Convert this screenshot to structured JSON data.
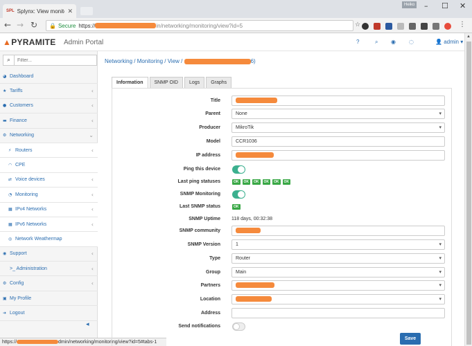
{
  "browser": {
    "tab_title": "Splynx: View monitoring",
    "tab_favicon": "SPL",
    "profile_name": "Heiko",
    "secure_label": "Secure",
    "url_scheme": "https://",
    "url_path": "in/networking/monitoring/view?id=5",
    "status_url_prefix": "https://",
    "status_url_suffix": "dmin/networking/monitoring/view?id=5#tabs-1"
  },
  "header": {
    "logo": "PYRAMITE",
    "portal_title": "Admin Portal",
    "user": "admin"
  },
  "sidebar": {
    "search_placeholder": "Filter...",
    "items": [
      {
        "icon": "dashboard-icon",
        "label": "Dashboard",
        "sub": false,
        "chevron": false
      },
      {
        "icon": "star-icon",
        "label": "Tariffs",
        "sub": false,
        "chevron": true
      },
      {
        "icon": "user-icon",
        "label": "Customers",
        "sub": false,
        "chevron": true
      },
      {
        "icon": "finance-icon",
        "label": "Finance",
        "sub": false,
        "chevron": true
      },
      {
        "icon": "network-icon",
        "label": "Networking",
        "sub": false,
        "chevron": true,
        "open": true
      },
      {
        "icon": "router-icon",
        "label": "Routers",
        "sub": true,
        "chevron": true
      },
      {
        "icon": "wifi-icon",
        "label": "CPE",
        "sub": true,
        "chevron": false
      },
      {
        "icon": "shuffle-icon",
        "label": "Voice devices",
        "sub": true,
        "chevron": true
      },
      {
        "icon": "monitor-icon",
        "label": "Monitoring",
        "sub": true,
        "chevron": true
      },
      {
        "icon": "grid-icon",
        "label": "IPv4 Networks",
        "sub": true,
        "chevron": true
      },
      {
        "icon": "grid-icon",
        "label": "IPv6 Networks",
        "sub": true,
        "chevron": true
      },
      {
        "icon": "globe-icon",
        "label": "Network Weathermap",
        "sub": true,
        "chevron": false
      },
      {
        "icon": "support-icon",
        "label": "Support",
        "sub": false,
        "chevron": true
      },
      {
        "icon": "terminal-icon",
        "label": ">_ Administration",
        "sub": false,
        "chevron": true
      },
      {
        "icon": "gear-icon",
        "label": "Config",
        "sub": false,
        "chevron": true
      },
      {
        "icon": "profile-icon",
        "label": "My Profile",
        "sub": false,
        "chevron": false
      },
      {
        "icon": "logout-icon",
        "label": "Logout",
        "sub": false,
        "chevron": false
      }
    ]
  },
  "breadcrumb": {
    "part1": "Networking",
    "part2": "Monitoring",
    "part3": "View",
    "sep": " / ",
    "tail": "6)"
  },
  "tabs": [
    "Information",
    "SNMP OID",
    "Logs",
    "Graphs"
  ],
  "form": {
    "title_label": "Title",
    "parent_label": "Parent",
    "parent_value": "None",
    "producer_label": "Producer",
    "producer_value": "MikroTik",
    "model_label": "Model",
    "model_value": "CCR1036",
    "ip_label": "IP address",
    "ping_label": "Ping this device",
    "ping_on": true,
    "last_ping_label": "Last ping statuses",
    "ping_statuses": [
      "OK",
      "OK",
      "OK",
      "OK",
      "OK",
      "OK"
    ],
    "snmp_mon_label": "SNMP Monitoring",
    "snmp_mon_on": true,
    "last_snmp_label": "Last SNMP status",
    "last_snmp_value": "OK",
    "uptime_label": "SNMP Uptime",
    "uptime_value": "118 days, 00:32:38",
    "community_label": "SNMP community",
    "version_label": "SNMP Version",
    "version_value": "1",
    "type_label": "Type",
    "type_value": "Router",
    "group_label": "Group",
    "group_value": "Main",
    "partners_label": "Partners",
    "location_label": "Location",
    "address_label": "Address",
    "notif_label": "Send notifications",
    "notif_on": false,
    "save_label": "Save"
  },
  "colors": {
    "accent": "#2a6db0",
    "toggle_on": "#3cb08f",
    "ok_badge": "#39a845",
    "logo_orange": "#e86b23"
  }
}
